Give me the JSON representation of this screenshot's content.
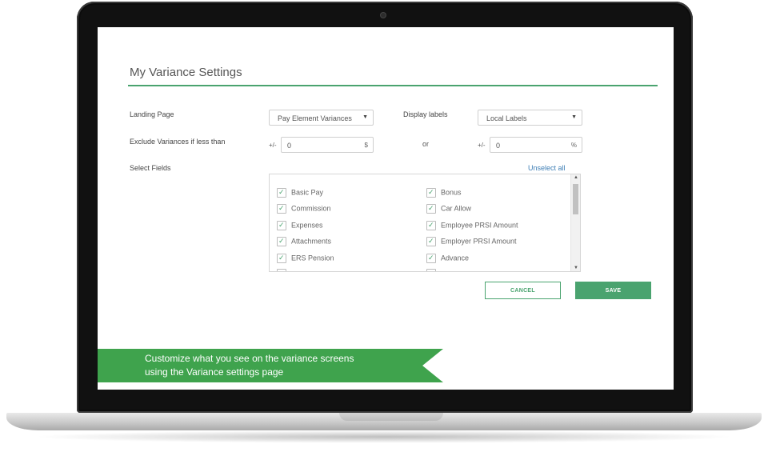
{
  "page": {
    "title": "My Variance Settings"
  },
  "form": {
    "landing_page_label": "Landing Page",
    "landing_page_value": "Pay Element Variances",
    "display_labels_label": "Display labels",
    "display_labels_value": "Local Labels",
    "exclude_label": "Exclude Variances if less than",
    "plus_minus": "+/-",
    "amount_value": "0",
    "amount_unit": "$",
    "or_label": "or",
    "percent_value": "0",
    "percent_unit": "%",
    "select_fields_label": "Select Fields",
    "unselect_all": "Unselect all"
  },
  "fields": {
    "left": [
      {
        "label": "Basic Pay",
        "checked": true
      },
      {
        "label": "Commission",
        "checked": true
      },
      {
        "label": "Expenses",
        "checked": true
      },
      {
        "label": "Attachments",
        "checked": true
      },
      {
        "label": "ERS Pension",
        "checked": true
      }
    ],
    "right": [
      {
        "label": "Bonus",
        "checked": true
      },
      {
        "label": "Car Allow",
        "checked": true
      },
      {
        "label": "Employee PRSI Amount",
        "checked": true
      },
      {
        "label": "Employer PRSI Amount",
        "checked": true
      },
      {
        "label": "Advance",
        "checked": true
      }
    ]
  },
  "buttons": {
    "cancel": "CANCEL",
    "save": "SAVE"
  },
  "banner": {
    "line1": "Customize what you see on the variance screens",
    "line2": "using the Variance settings page"
  },
  "colors": {
    "accent": "#4aa36f",
    "banner": "#3fa34d",
    "link": "#3f7fb5"
  },
  "icons": {
    "checkbox": "check-icon",
    "dropdown": "caret-down-icon"
  }
}
